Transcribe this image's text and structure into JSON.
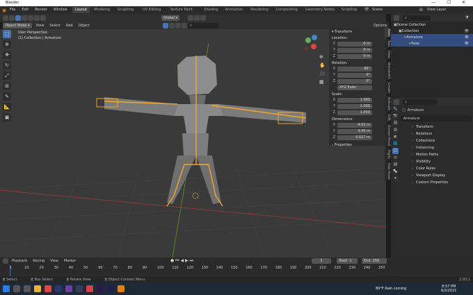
{
  "window": {
    "title": "Blender",
    "min": "—",
    "max": "☐",
    "close": "✕"
  },
  "menu": [
    "File",
    "Edit",
    "Render",
    "Window",
    "Help"
  ],
  "workspaces": [
    "Layout",
    "Modeling",
    "Sculpting",
    "UV Editing",
    "Texture Paint",
    "Shading",
    "Animation",
    "Rendering",
    "Compositing",
    "Geometry Nodes",
    "Scripting"
  ],
  "scene": {
    "label": "Scene",
    "view_layer": "View Layer"
  },
  "header": {
    "mode": "Object Mode",
    "menus": [
      "View",
      "Select",
      "Add",
      "Object"
    ],
    "orientation": "Global",
    "options": "Options"
  },
  "viewport": {
    "view_name": "User Perspective",
    "collection": "(1) Collection | Armature"
  },
  "npanel": {
    "title": "Transform",
    "location_label": "Location:",
    "location": [
      {
        "axis": "X",
        "value": "0 m"
      },
      {
        "axis": "Y",
        "value": "0 m"
      },
      {
        "axis": "Z",
        "value": "0 m"
      }
    ],
    "rotation_label": "Rotation:",
    "rotation": [
      {
        "axis": "X",
        "value": "90°"
      },
      {
        "axis": "Y",
        "value": "0°"
      },
      {
        "axis": "Z",
        "value": "0°"
      }
    ],
    "rotation_mode": "XYZ Euler",
    "scale_label": "Scale:",
    "scale": [
      {
        "axis": "X",
        "value": "1.000"
      },
      {
        "axis": "Y",
        "value": "1.000"
      },
      {
        "axis": "Z",
        "value": "1.000"
      }
    ],
    "dimensions_label": "Dimensions:",
    "dimensions": [
      {
        "axis": "X",
        "value": "4.62 m"
      },
      {
        "axis": "Y",
        "value": "3.45 m"
      },
      {
        "axis": "Z",
        "value": "0.627 m"
      }
    ],
    "properties": "Properties"
  },
  "ntabs": [
    "Item",
    "Tool",
    "View",
    "BlenderKit",
    "Create",
    "Animate",
    "Edit",
    "Grease Pencil",
    "Rigify",
    "Rain Snow"
  ],
  "outliner": {
    "rows": [
      {
        "label": "Scene Collection",
        "indent": 0
      },
      {
        "label": "Collection",
        "indent": 1
      },
      {
        "label": "Armature",
        "indent": 2
      },
      {
        "label": "Pose",
        "indent": 3
      }
    ]
  },
  "properties": {
    "object_name": "Armature",
    "sections": [
      "Transform",
      "Relations",
      "Collections",
      "Instancing",
      "Motion Paths",
      "Visibility",
      "Color Rules",
      "Viewport Display",
      "Custom Properties"
    ]
  },
  "timeline": {
    "menus": [
      "Playback",
      "Keying",
      "View",
      "Marker"
    ],
    "current_frame": "1",
    "start_label": "Start",
    "start": "1",
    "end_label": "End",
    "end": "250",
    "ticks": [
      "1",
      "10",
      "20",
      "30",
      "40",
      "50",
      "60",
      "70",
      "80",
      "90",
      "100",
      "110",
      "120",
      "130",
      "140",
      "150",
      "160",
      "170",
      "180",
      "190",
      "200",
      "210",
      "220",
      "230",
      "240",
      "250"
    ]
  },
  "status": {
    "items": [
      "Select",
      "Box Select",
      "Rotate View",
      "Object Context Menu"
    ],
    "version": "2.93.1"
  },
  "taskbar": {
    "weather": "80°F  Rain coming",
    "time": "8:57 PM",
    "date": "6/2/2021"
  },
  "colors": {
    "accent": "#4772b3",
    "selection": "#f5a623",
    "grid_x": "#9c3b3b",
    "grid_y": "#6b8e23"
  }
}
